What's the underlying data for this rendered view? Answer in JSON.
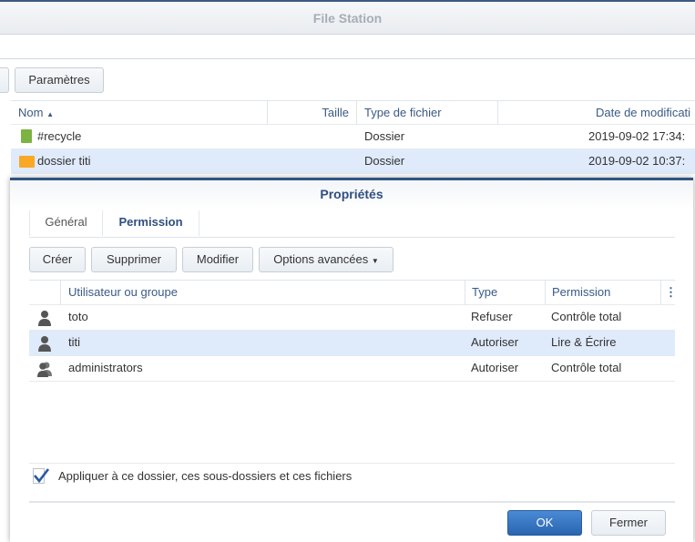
{
  "app": {
    "title": "File Station"
  },
  "toolbar": {
    "settings_label": "Paramètres"
  },
  "file_table": {
    "columns": [
      "Nom",
      "Taille",
      "Type de fichier",
      "Date de modificati"
    ],
    "rows": [
      {
        "name": "#recycle",
        "size": "",
        "type": "Dossier",
        "date": "2019-09-02 17:34:",
        "icon": "recycle-bin-icon"
      },
      {
        "name": "dossier titi",
        "size": "",
        "type": "Dossier",
        "date": "2019-09-02 10:37:",
        "icon": "folder-icon"
      }
    ]
  },
  "dialog": {
    "title": "Propriétés",
    "tabs": [
      "Général",
      "Permission"
    ],
    "active_tab": "Permission",
    "buttons": {
      "create": "Créer",
      "delete": "Supprimer",
      "edit": "Modifier",
      "advanced": "Options avancées"
    },
    "columns": [
      "Utilisateur ou groupe",
      "Type",
      "Permission"
    ],
    "rows": [
      {
        "user": "toto",
        "type": "Refuser",
        "permission": "Contrôle total",
        "icon": "user-icon"
      },
      {
        "user": "titi",
        "type": "Autoriser",
        "permission": "Lire & Écrire",
        "icon": "user-icon"
      },
      {
        "user": "administrators",
        "type": "Autoriser",
        "permission": "Contrôle total",
        "icon": "group-icon"
      }
    ],
    "apply_label": "Appliquer à ce dossier, ces sous-dossiers et ces fichiers",
    "apply_checked": true,
    "ok_label": "OK",
    "close_label": "Fermer"
  }
}
